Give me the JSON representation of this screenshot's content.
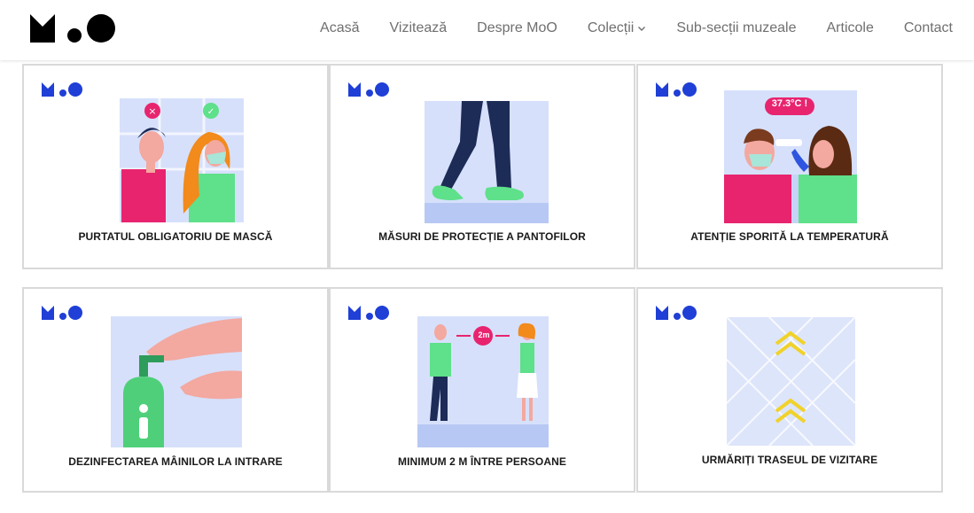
{
  "brand": {
    "logo_name": "MoO",
    "logo_color": "#000000",
    "card_logo_color": "#1f3fd6"
  },
  "nav": {
    "items": [
      {
        "label": "Acasă"
      },
      {
        "label": "Vizitează"
      },
      {
        "label": "Despre MoO"
      },
      {
        "label": "Colecții",
        "has_dropdown": true
      },
      {
        "label": "Sub-secții muzeale"
      },
      {
        "label": "Articole"
      },
      {
        "label": "Contact"
      }
    ]
  },
  "cards": [
    {
      "caption": "PURTATUL OBLIGATORIU DE MASCĂ",
      "icon": "mask-illustration"
    },
    {
      "caption": "MĂSURI DE PROTECȚIE A PANTOFILOR",
      "icon": "shoe-cover-illustration"
    },
    {
      "caption": "ATENȚIE SPORITĂ LA TEMPERATURĂ",
      "icon": "temperature-check-illustration",
      "badge": "37.3°C !"
    },
    {
      "caption": "DEZINFECTAREA MÂINILOR LA INTRARE",
      "icon": "hand-sanitizer-illustration"
    },
    {
      "caption": "MINIMUM 2 M ÎNTRE PERSOANE",
      "icon": "distance-illustration",
      "badge": "2m"
    },
    {
      "caption": "URMĂRIȚI TRASEUL DE VIZITARE",
      "icon": "route-arrows-illustration"
    }
  ],
  "colors": {
    "accent_pink": "#e8246f",
    "accent_green": "#5fe08a",
    "illus_bg": "#d6e0fb",
    "arrow_yellow": "#f0d22a"
  }
}
